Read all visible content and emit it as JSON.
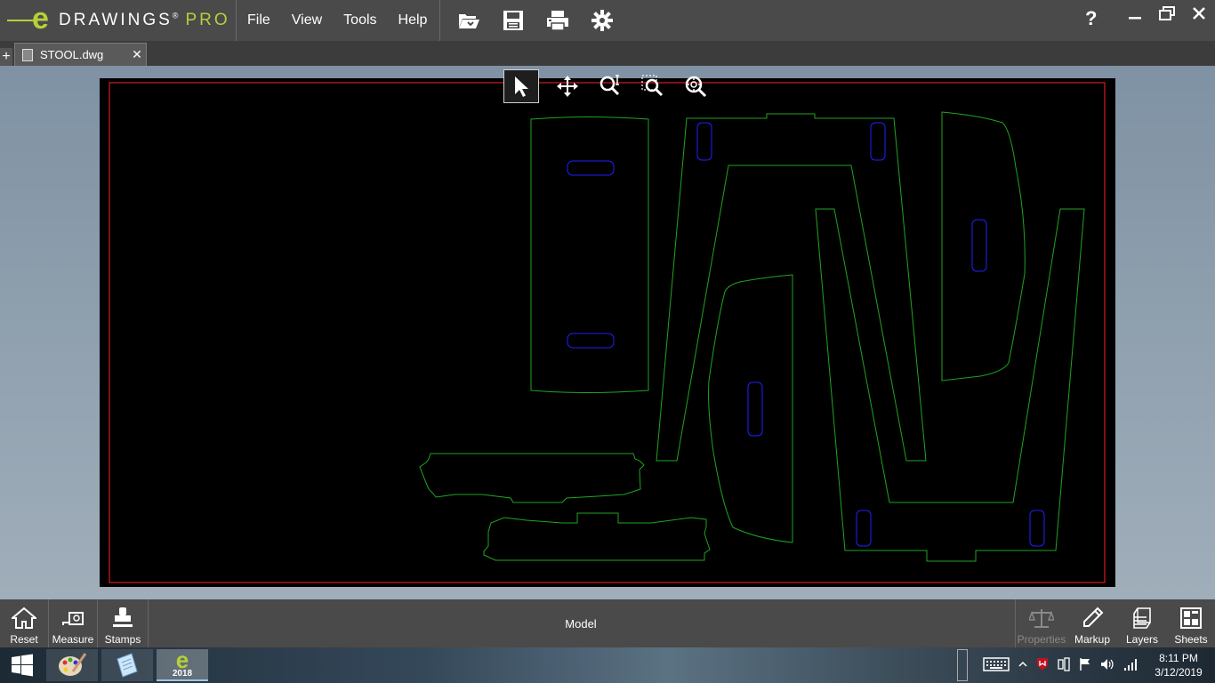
{
  "app": {
    "logo_e": "e",
    "logo_name": "DRAWINGS",
    "logo_trademark": "®",
    "logo_edition": "PRO"
  },
  "menu": [
    "File",
    "View",
    "Tools",
    "Help"
  ],
  "toolbar_icons": [
    "open-icon",
    "save-icon",
    "print-icon",
    "settings-icon"
  ],
  "help_label": "?",
  "tabs": {
    "new_tab_label": "+",
    "items": [
      {
        "label": "STOOL.dwg",
        "close": "✕"
      }
    ]
  },
  "view_tools": [
    "select-arrow-icon",
    "pan-icon",
    "zoom-icon",
    "zoom-to-area-icon",
    "zoom-to-fit-icon"
  ],
  "bottom_left": [
    {
      "label": "Reset",
      "icon": "home-icon"
    },
    {
      "label": "Measure",
      "icon": "measure-icon"
    },
    {
      "label": "Stamps",
      "icon": "stamp-icon"
    }
  ],
  "model_label": "Model",
  "bottom_right": [
    {
      "label": "Properties",
      "icon": "scale-icon",
      "enabled": false
    },
    {
      "label": "Markup",
      "icon": "pen-icon",
      "enabled": true
    },
    {
      "label": "Layers",
      "icon": "layers-icon",
      "enabled": true
    },
    {
      "label": "Sheets",
      "icon": "sheets-icon",
      "enabled": true
    }
  ],
  "taskbar": {
    "edrawings_badge": "2018",
    "clock_time": "8:11 PM",
    "clock_date": "3/12/2019"
  },
  "colors": {
    "border": "#ff2020",
    "outline": "#1fa51f",
    "slots": "#2020ff",
    "accent": "#b6cf3a"
  }
}
